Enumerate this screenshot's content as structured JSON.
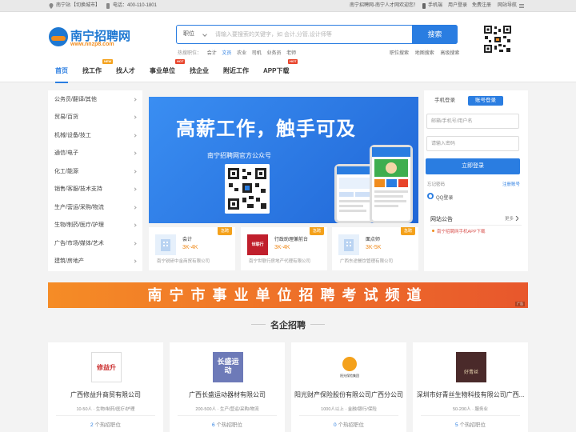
{
  "topbar": {
    "location": "南宁站",
    "switch_city": "【切换城市】",
    "phone": "电话：400-110-1801",
    "welcome": "南宁招聘网-南宁人才网欢迎您！",
    "mobile": "手机端",
    "login": "用户登录",
    "register": "免费注册",
    "site_nav": "网站导航"
  },
  "logo": {
    "name": "南宁招聘网",
    "url": "www.nnzp8.com"
  },
  "search": {
    "category": "职位",
    "placeholder": "请输入要搜索的关键字，如 会计,分管,设计师等",
    "button": "搜索"
  },
  "hot_search": {
    "label": "热搜职位：",
    "items": [
      "会计",
      "文员",
      "农业",
      "司机",
      "业务员",
      "老师"
    ]
  },
  "sublinks": [
    "职位搜索",
    "地图搜索",
    "高级搜索"
  ],
  "nav": {
    "items": [
      {
        "label": "首页",
        "badge": ""
      },
      {
        "label": "找工作",
        "badge": "NEW"
      },
      {
        "label": "找人才",
        "badge": ""
      },
      {
        "label": "事业单位",
        "badge": "HOT"
      },
      {
        "label": "找企业",
        "badge": ""
      },
      {
        "label": "附近工作",
        "badge": ""
      },
      {
        "label": "APP下载",
        "badge": "HOT"
      }
    ]
  },
  "categories": [
    "公务员/翻译/其他",
    "贸易/百货",
    "机械/设备/技工",
    "通信/电子",
    "化工/能源",
    "销售/客服/技术支持",
    "生产/营运/采购/物流",
    "生物/制药/医疗/护理",
    "广告/市场/媒体/艺术",
    "建筑/房地产"
  ],
  "banner": {
    "title": "高薪工作，触手可及",
    "subtitle": "南宁招聘网官方公众号"
  },
  "job_cards": [
    {
      "title": "会计",
      "salary": "3K-4K",
      "company": "南宁锐研中金商贸有限公司",
      "tag": "急聘"
    },
    {
      "title": "行政助理兼前台",
      "salary": "3K-4K",
      "company": "南宁世联行房地产代理有限公司",
      "tag": "急聘",
      "logo_text": "世联行"
    },
    {
      "title": "面点师",
      "salary": "3K-5K",
      "company": "广西东途餐饮管理有限公司",
      "tag": "急聘"
    }
  ],
  "login": {
    "tab_mobile": "手机登录",
    "tab_account": "账号登录",
    "username_placeholder": "邮箱/手机号/用户名",
    "password_placeholder": "请输入密码",
    "button": "立即登录",
    "forgot": "忘记密码",
    "register": "注册账号",
    "qq": "QQ登录"
  },
  "notice": {
    "title": "网站公告",
    "more": "更多",
    "items": [
      "南宁招聘网手机APP下载"
    ]
  },
  "banner2": {
    "text": "南宁市事业单位招聘考试频道",
    "ad": "广告"
  },
  "famous": {
    "title": "名企招聘",
    "companies": [
      {
        "name": "广西修益升商贸有限公司",
        "meta": "10-50人 · 生物/制药/医疗/护理",
        "jobs": "2",
        "jobs_suffix": " 个热招职位",
        "logo_text": "修益升"
      },
      {
        "name": "广西长盛运动器材有限公司",
        "meta": "200-500人 · 生产/营运/采购/物流",
        "jobs": "6",
        "jobs_suffix": " 个热招职位",
        "logo_text": "长盛运动"
      },
      {
        "name": "阳光财产保险股份有限公司广西分公司",
        "meta": "1000人以上 · 金融/银行/保险",
        "jobs": "0",
        "jobs_suffix": " 个热招职位",
        "logo_text": "阳光保险集团"
      },
      {
        "name": "深圳市好青丝生物科技有限公司广西...",
        "meta": "50-200人 · 服务业",
        "jobs": "5",
        "jobs_suffix": " 个热招职位",
        "logo_text": "好青丝"
      }
    ]
  },
  "colors": {
    "primary": "#2a7de1",
    "accent": "#f08c1e",
    "hot": "#e8442b",
    "new": "#f4a11b"
  }
}
